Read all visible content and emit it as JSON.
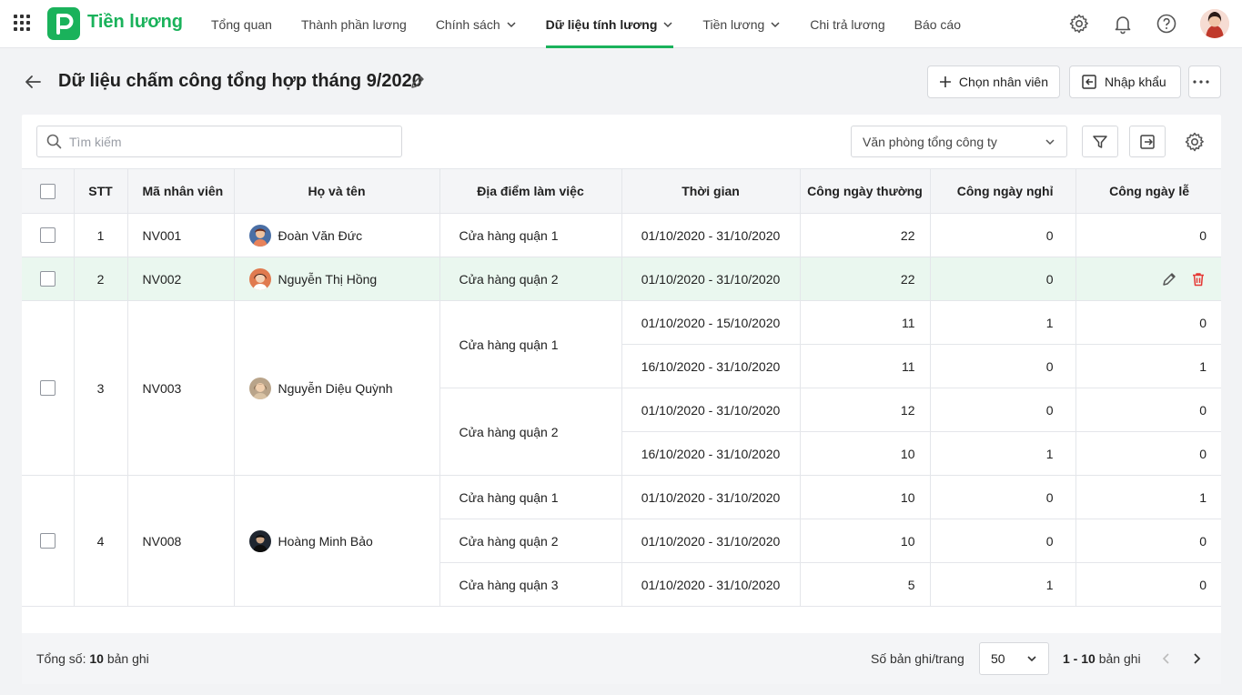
{
  "app": {
    "brand": "Tiền lương"
  },
  "nav": [
    {
      "label": "Tổng quan",
      "dropdown": false,
      "active": false
    },
    {
      "label": "Thành phần lương",
      "dropdown": false,
      "active": false
    },
    {
      "label": "Chính sách",
      "dropdown": true,
      "active": false
    },
    {
      "label": "Dữ liệu tính lương",
      "dropdown": true,
      "active": true
    },
    {
      "label": "Tiền lương",
      "dropdown": true,
      "active": false
    },
    {
      "label": "Chi trả lương",
      "dropdown": false,
      "active": false
    },
    {
      "label": "Báo cáo",
      "dropdown": false,
      "active": false
    }
  ],
  "page": {
    "title": "Dữ liệu chấm công tổng hợp tháng 9/2020",
    "choose_employee": "Chọn nhân viên",
    "import": "Nhập khẩu"
  },
  "toolbar": {
    "search_placeholder": "Tìm kiếm",
    "org_unit": "Văn phòng tổng công ty"
  },
  "table": {
    "headers": {
      "stt": "STT",
      "code": "Mã nhân viên",
      "name": "Họ và tên",
      "location": "Địa điểm làm việc",
      "period": "Thời gian",
      "weekday": "Công ngày thường",
      "dayoff": "Công ngày nghỉ",
      "holiday": "Công ngày lễ"
    },
    "rows": [
      {
        "stt": "1",
        "code": "NV001",
        "name": "Đoàn Văn Đức",
        "location": "Cửa hàng quận 1",
        "period": "01/10/2020 - 31/10/2020",
        "weekday": "22",
        "dayoff": "0",
        "holiday": "0"
      },
      {
        "stt": "2",
        "code": "NV002",
        "name": "Nguyễn Thị Hồng",
        "location": "Cửa hàng quận 2",
        "period": "01/10/2020 - 31/10/2020",
        "weekday": "22",
        "dayoff": "0"
      },
      {
        "stt": "3",
        "code": "NV003",
        "name": "Nguyễn Diệu Quỳnh",
        "locations": [
          "Cửa hàng quận 1",
          "Cửa hàng quận 2"
        ],
        "lines": [
          {
            "period": "01/10/2020 - 15/10/2020",
            "weekday": "11",
            "dayoff": "1",
            "holiday": "0"
          },
          {
            "period": "16/10/2020 - 31/10/2020",
            "weekday": "11",
            "dayoff": "0",
            "holiday": "1"
          },
          {
            "period": "01/10/2020 - 31/10/2020",
            "weekday": "12",
            "dayoff": "0",
            "holiday": "0"
          },
          {
            "period": "16/10/2020 - 31/10/2020",
            "weekday": "10",
            "dayoff": "1",
            "holiday": "0"
          }
        ]
      },
      {
        "stt": "4",
        "code": "NV008",
        "name": "Hoàng Minh Bảo",
        "lines": [
          {
            "location": "Cửa hàng quận 1",
            "period": "01/10/2020 - 31/10/2020",
            "weekday": "10",
            "dayoff": "0",
            "holiday": "1"
          },
          {
            "location": "Cửa hàng quận 2",
            "period": "01/10/2020 - 31/10/2020",
            "weekday": "10",
            "dayoff": "0",
            "holiday": "0"
          },
          {
            "location": "Cửa hàng quận 3",
            "period": "01/10/2020 - 31/10/2020",
            "weekday": "5",
            "dayoff": "1",
            "holiday": "0"
          }
        ]
      }
    ]
  },
  "footer": {
    "total_label": "Tổng số:",
    "total_count": "10",
    "total_unit": "bản ghi",
    "per_page_label": "Số bản ghi/trang",
    "per_page": "50",
    "range": "1 - 10",
    "range_unit": "bản ghi"
  },
  "icons": [
    "apps-icon",
    "gear-icon",
    "bell-icon",
    "help-icon",
    "back-arrow-icon",
    "pencil-icon",
    "plus-icon",
    "import-icon",
    "more-icon",
    "search-icon",
    "chevron-down-icon",
    "filter-icon",
    "export-icon",
    "trash-icon",
    "chevron-left-icon",
    "chevron-right-icon"
  ],
  "colors": {
    "accent": "#1ab25b",
    "row_highlight": "#eaf7ef",
    "delete": "#e53935"
  }
}
